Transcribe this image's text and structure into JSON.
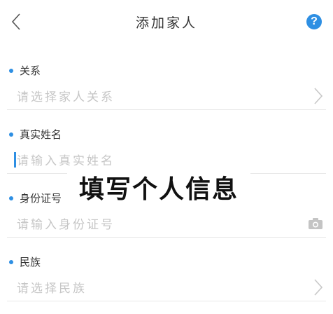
{
  "header": {
    "title": "添加家人",
    "back_icon": "chevron-left-icon",
    "help_symbol": "?"
  },
  "fields": [
    {
      "label": "关系",
      "placeholder": "请选择家人关系",
      "trailing_icon": "chevron-right-icon"
    },
    {
      "label": "真实姓名",
      "placeholder": "请输入真实姓名",
      "trailing_icon": ""
    },
    {
      "label": "身份证号",
      "placeholder": "请输入身份证号",
      "trailing_icon": "camera-icon"
    },
    {
      "label": "民族",
      "placeholder": "请选择民族",
      "trailing_icon": "chevron-right-icon"
    }
  ],
  "overlay": {
    "caption": "填写个人信息"
  },
  "colors": {
    "accent": "#2e8fe3",
    "placeholder": "#c6c6c6",
    "label": "#333333",
    "divider": "#e8e8e8"
  }
}
